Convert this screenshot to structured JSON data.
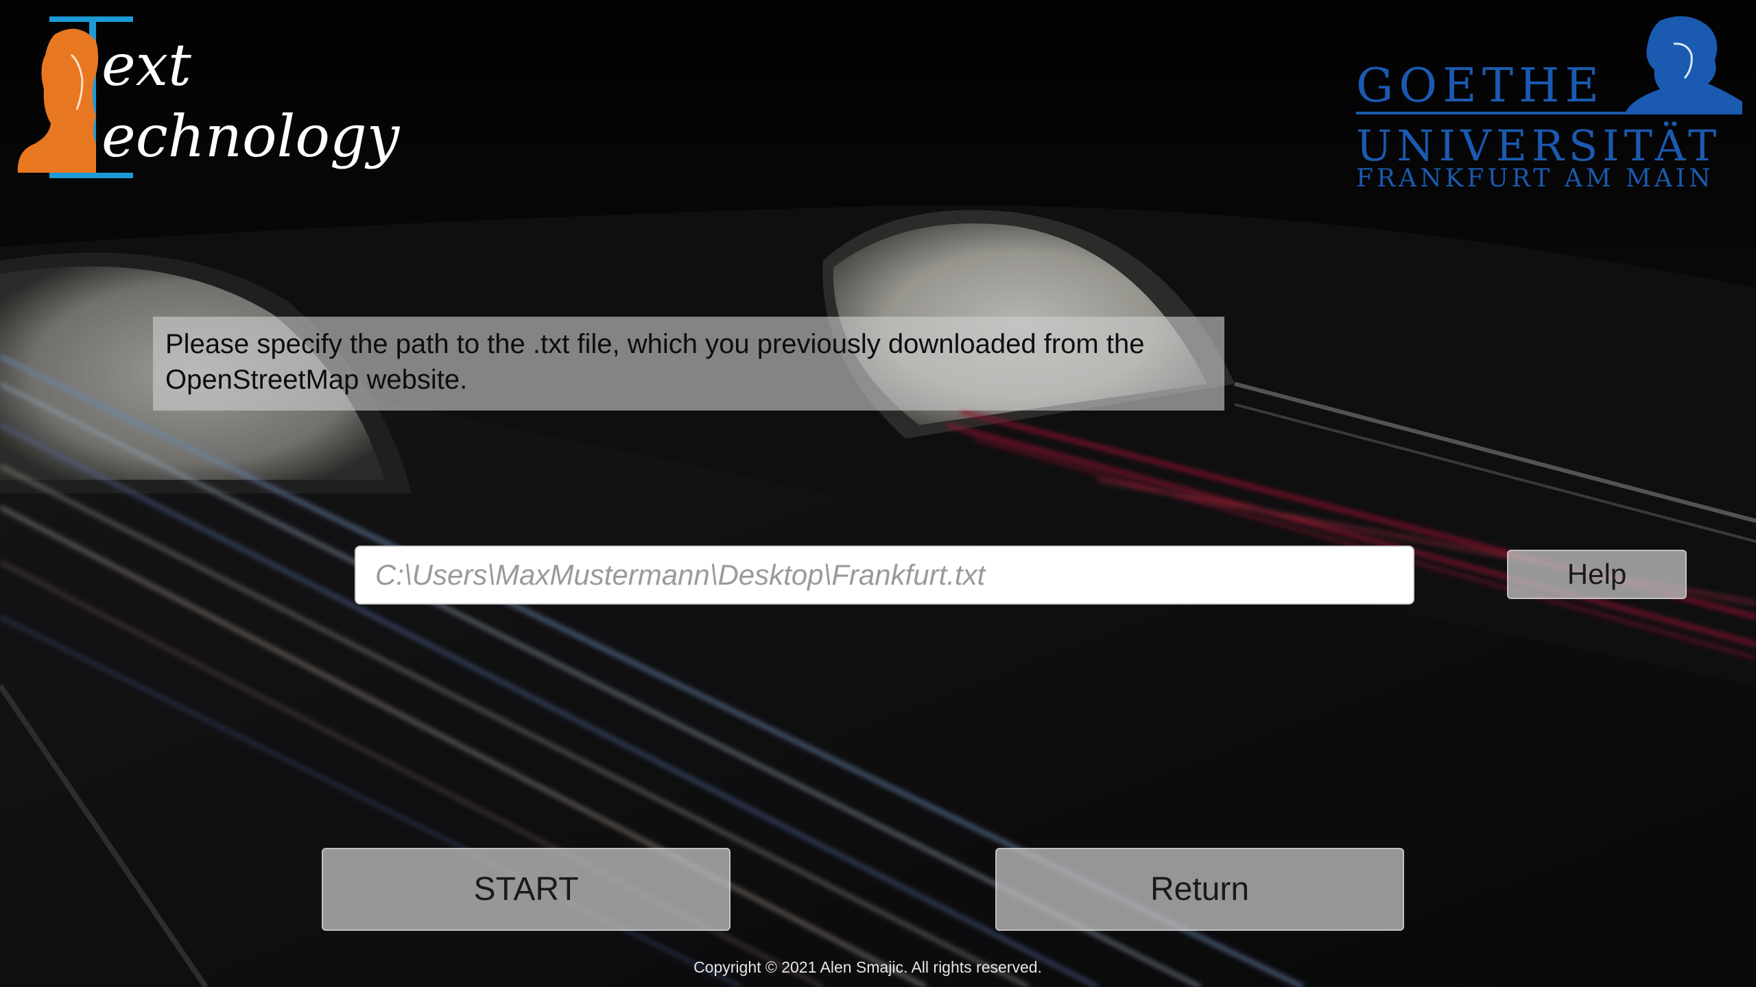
{
  "logos": {
    "text_technology": {
      "word_1": "ext",
      "word_2": "echnology",
      "accent_color": "#e87722",
      "frame_color": "#1e9ad6"
    },
    "goethe": {
      "line_1": "GOETHE",
      "line_2": "UNIVERSITÄT",
      "line_3": "FRANKFURT AM MAIN",
      "brand_color": "#1a5ab0"
    }
  },
  "instruction": {
    "text": "Please specify the path to the .txt file, which you previously downloaded from the OpenStreetMap website."
  },
  "path_input": {
    "value": "",
    "placeholder": "C:\\Users\\MaxMustermann\\Desktop\\Frankfurt.txt"
  },
  "buttons": {
    "help": "Help",
    "start": "START",
    "return": "Return"
  },
  "footer": {
    "copyright": "Copyright © 2021 Alen Smajic. All rights reserved."
  },
  "background": {
    "icon": "night-highway-tunnel-light-trails"
  }
}
